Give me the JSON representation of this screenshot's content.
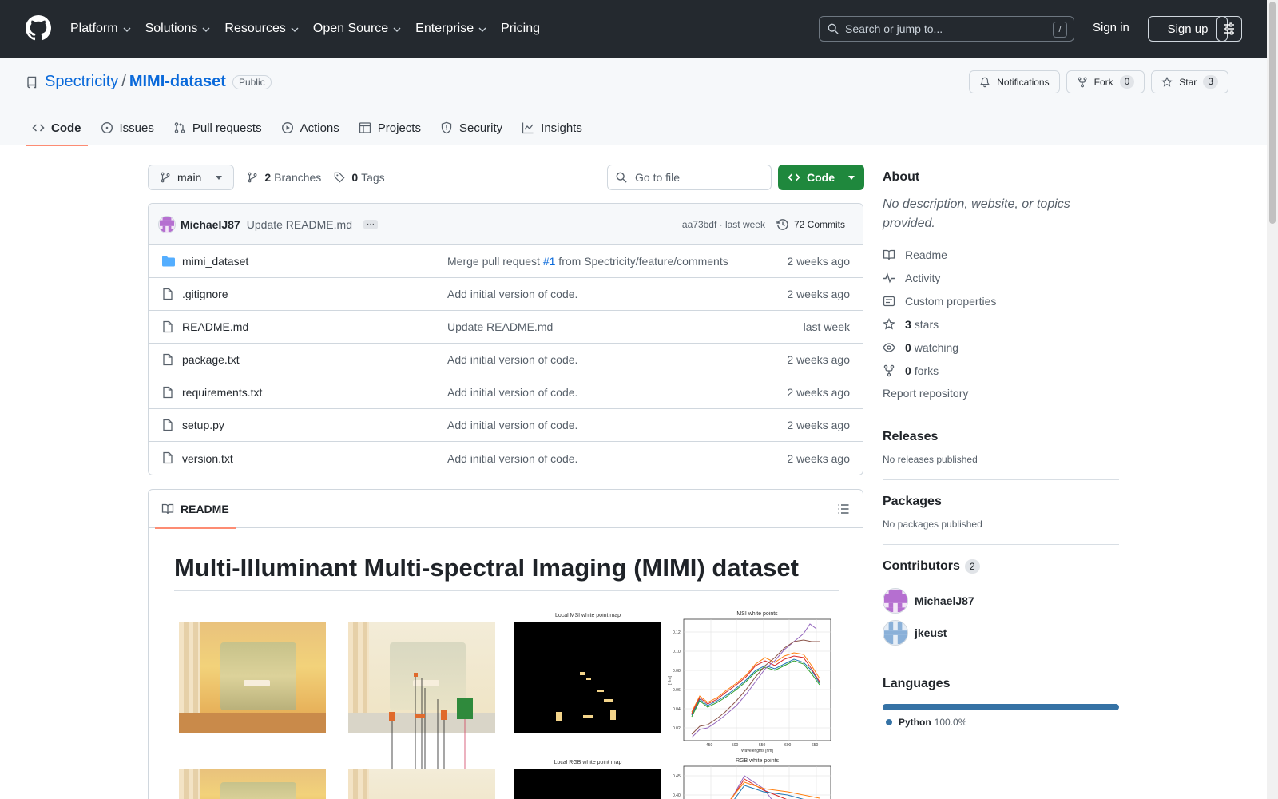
{
  "header": {
    "nav": [
      "Platform",
      "Solutions",
      "Resources",
      "Open Source",
      "Enterprise",
      "Pricing"
    ],
    "search_placeholder": "Search or jump to...",
    "search_shortcut": "/",
    "sign_in": "Sign in",
    "sign_up": "Sign up"
  },
  "repo": {
    "owner": "Spectricity",
    "separator": "/",
    "name": "MIMI-dataset",
    "visibility": "Public",
    "notifications_label": "Notifications",
    "fork_label": "Fork",
    "fork_count": "0",
    "star_label": "Star",
    "star_count": "3",
    "tabs": [
      "Code",
      "Issues",
      "Pull requests",
      "Actions",
      "Projects",
      "Security",
      "Insights"
    ]
  },
  "toolbar": {
    "branch": "main",
    "branches_count": "2",
    "branches_label": "Branches",
    "tags_count": "0",
    "tags_label": "Tags",
    "goto_placeholder": "Go to file",
    "code_button": "Code"
  },
  "commit": {
    "author": "MichaelJ87",
    "message": "Update README.md",
    "ellipsis": "···",
    "hash_time": "aa73bdf · last week",
    "commits_label": "72 Commits"
  },
  "files": [
    {
      "name": "mimi_dataset",
      "type": "folder",
      "msg_pre": "Merge pull request ",
      "msg_link": "#1",
      "msg_post": " from Spectricity/feature/comments",
      "date": "2 weeks ago"
    },
    {
      "name": ".gitignore",
      "type": "file",
      "msg_pre": "Add initial version of code.",
      "msg_link": "",
      "msg_post": "",
      "date": "2 weeks ago"
    },
    {
      "name": "README.md",
      "type": "file",
      "msg_pre": "Update README.md",
      "msg_link": "",
      "msg_post": "",
      "date": "last week"
    },
    {
      "name": "package.txt",
      "type": "file",
      "msg_pre": "Add initial version of code.",
      "msg_link": "",
      "msg_post": "",
      "date": "2 weeks ago"
    },
    {
      "name": "requirements.txt",
      "type": "file",
      "msg_pre": "Add initial version of code.",
      "msg_link": "",
      "msg_post": "",
      "date": "2 weeks ago"
    },
    {
      "name": "setup.py",
      "type": "file",
      "msg_pre": "Add initial version of code.",
      "msg_link": "",
      "msg_post": "",
      "date": "2 weeks ago"
    },
    {
      "name": "version.txt",
      "type": "file",
      "msg_pre": "Add initial version of code.",
      "msg_link": "",
      "msg_post": "",
      "date": "2 weeks ago"
    }
  ],
  "readme": {
    "tab_label": "README",
    "title": "Multi-Illuminant Multi-spectral Imaging (MIMI) dataset",
    "fig_labels": {
      "local_msi": "Local MSI white point map",
      "msi_white": "MSI white points",
      "local_rgb": "Local RGB white point map",
      "rgb_white": "RGB white points",
      "wavelengths": "Wavelengths [nm]",
      "y_axis": "[~lm]",
      "x_ticks": [
        "450",
        "500",
        "550",
        "600",
        "650"
      ],
      "y_ticks": [
        "0.02",
        "0.04",
        "0.06",
        "0.08",
        "0.10",
        "0.12"
      ],
      "rgb_y_ticks": [
        "0.45",
        "0.40"
      ]
    }
  },
  "sidebar": {
    "about_title": "About",
    "about_desc": "No description, website, or topics provided.",
    "links": [
      {
        "icon": "book-icon",
        "label": "Readme",
        "count": ""
      },
      {
        "icon": "pulse-icon",
        "label": "Activity",
        "count": ""
      },
      {
        "icon": "note-icon",
        "label": "Custom properties",
        "count": ""
      },
      {
        "icon": "star-icon",
        "label": "stars",
        "count": "3"
      },
      {
        "icon": "eye-icon",
        "label": "watching",
        "count": "0"
      },
      {
        "icon": "fork-icon",
        "label": "forks",
        "count": "0"
      }
    ],
    "report": "Report repository",
    "releases_title": "Releases",
    "releases_empty": "No releases published",
    "packages_title": "Packages",
    "packages_empty": "No packages published",
    "contributors_title": "Contributors",
    "contributors_count": "2",
    "contributors": [
      "MichaelJ87",
      "jkeust"
    ],
    "languages_title": "Languages",
    "language_name": "Python",
    "language_pct": "100.0%",
    "language_color": "#3572A5"
  },
  "colors": {
    "header_bg": "#24292f",
    "link": "#0969da",
    "code_button": "#1f883d",
    "active_tab_underline": "#fd8c73"
  }
}
